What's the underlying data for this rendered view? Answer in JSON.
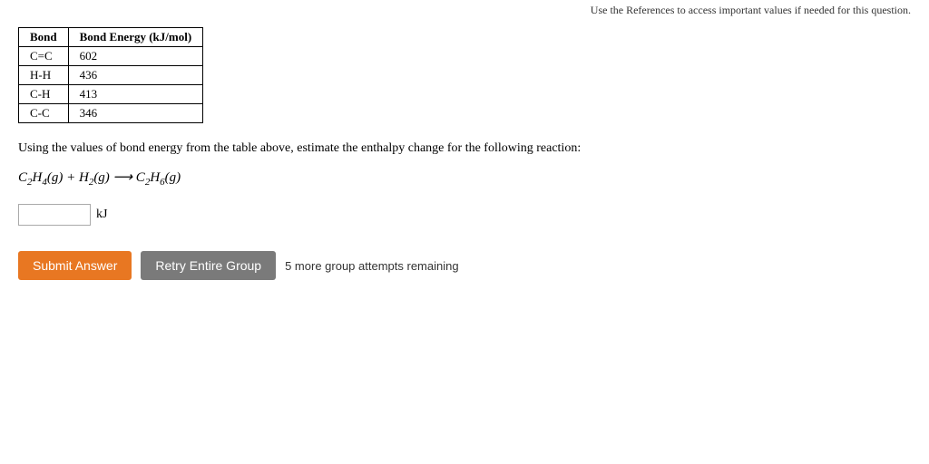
{
  "header": {
    "note": "Use the References to access important values if needed for this question."
  },
  "table": {
    "col1_header": "Bond",
    "col2_header": "Bond Energy (kJ/mol)",
    "rows": [
      {
        "bond": "C=C",
        "energy": "602"
      },
      {
        "bond": "H-H",
        "energy": "436"
      },
      {
        "bond": "C-H",
        "energy": "413"
      },
      {
        "bond": "C-C",
        "energy": "346"
      }
    ]
  },
  "instruction": "Using the values of bond energy from the table above, estimate the enthalpy change for the following reaction:",
  "reaction": {
    "reactant1": "C₂H₄(g)",
    "plus": "+",
    "reactant2": "H₂(g)",
    "arrow": "⟶",
    "product": "C₂H₆(g)"
  },
  "answer": {
    "placeholder": "",
    "unit": "kJ"
  },
  "buttons": {
    "submit_label": "Submit Answer",
    "retry_label": "Retry Entire Group",
    "attempts_text": "5 more group attempts remaining"
  }
}
